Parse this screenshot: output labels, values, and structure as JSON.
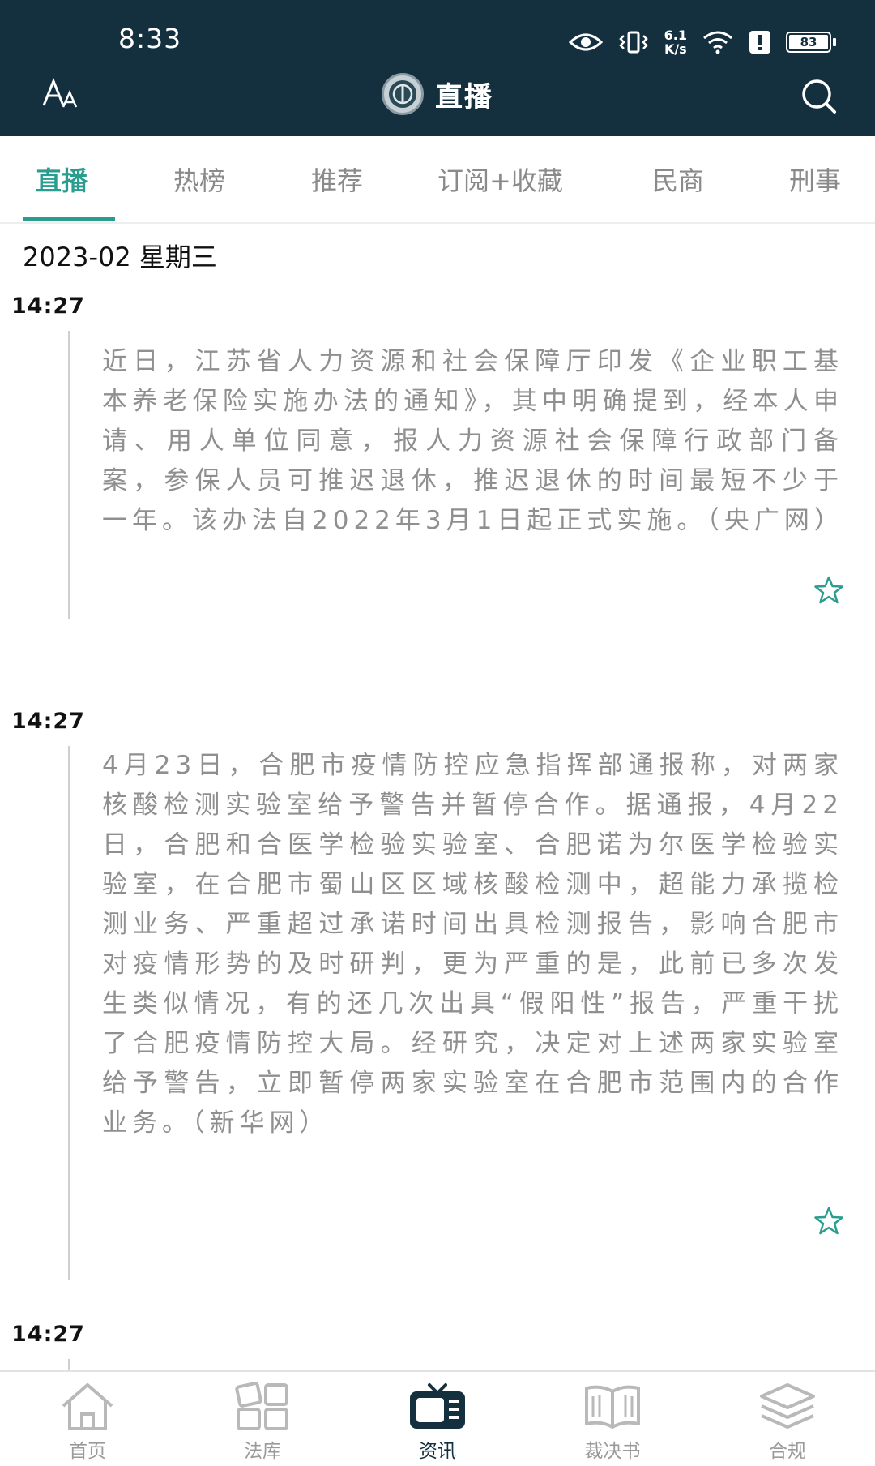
{
  "status_bar": {
    "time": "8:33",
    "net_speed_value": "6.1",
    "net_speed_unit": "K/s",
    "battery": "83"
  },
  "header": {
    "title": "直播",
    "font_icon": "font-size-icon",
    "search_icon": "search-icon",
    "bg_color": "#14303f"
  },
  "tabs": [
    {
      "label": "直播",
      "active": true
    },
    {
      "label": "热榜",
      "active": false
    },
    {
      "label": "推荐",
      "active": false
    },
    {
      "label": "订阅+收藏",
      "active": false
    },
    {
      "label": "民商",
      "active": false
    },
    {
      "label": "刑事",
      "active": false
    }
  ],
  "accent_color": "#2a9d8f",
  "feed": {
    "date": "2023-02 星期三",
    "items": [
      {
        "time": "14:27",
        "text": "近日，江苏省人力资源和社会保障厅印发《企业职工基本养老保险实施办法的通知》，其中明确提到，经本人申请、用人单位同意，报人力资源社会保障行政部门备案，参保人员可推迟退休，推迟退休的时间最短不少于一年。该办法自2022年3月1日起正式实施。（央广网）"
      },
      {
        "time": "14:27",
        "text": "4月23日，合肥市疫情防控应急指挥部通报称，对两家核酸检测实验室给予警告并暂停合作。据通报，4月22日，合肥和合医学检验实验室、合肥诺为尔医学检验实验室，在合肥市蜀山区区域核酸检测中，超能力承揽检测业务、严重超过承诺时间出具检测报告，影响合肥市对疫情形势的及时研判，更为严重的是，此前已多次发生类似情况，有的还几次出具“假阳性”报告，严重干扰了合肥疫情防控大局。经研究，决定对上述两家实验室给予警告，立即暂停两家实验室在合肥市范围内的合作业务。（新华网）"
      },
      {
        "time": "14:27",
        "text": ""
      }
    ]
  },
  "bottom_nav": [
    {
      "label": "首页",
      "icon": "home-icon",
      "active": false
    },
    {
      "label": "法库",
      "icon": "grid-icon",
      "active": false
    },
    {
      "label": "资讯",
      "icon": "tv-icon",
      "active": true
    },
    {
      "label": "裁决书",
      "icon": "book-icon",
      "active": false
    },
    {
      "label": "合规",
      "icon": "layers-icon",
      "active": false
    }
  ]
}
